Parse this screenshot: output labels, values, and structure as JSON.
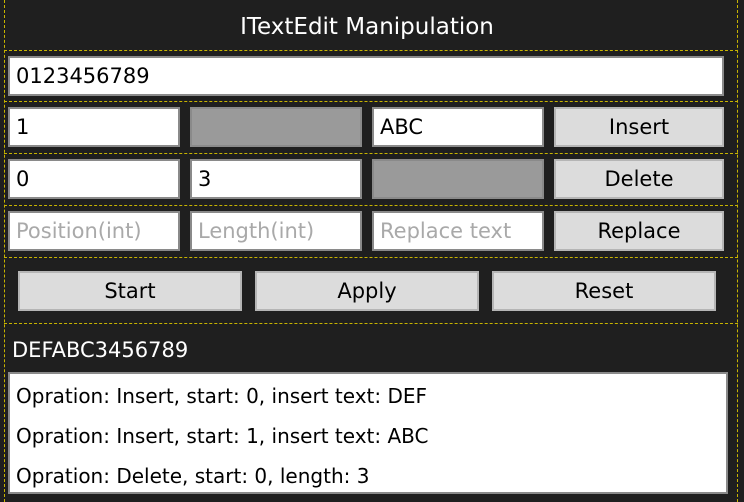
{
  "title": "ITextEdit Manipulation",
  "text_value": "0123456789",
  "insert_row": {
    "position": "1",
    "text": "ABC",
    "button": "Insert"
  },
  "delete_row": {
    "position": "0",
    "length": "3",
    "button": "Delete"
  },
  "replace_row": {
    "position_placeholder": "Position(int)",
    "length_placeholder": "Length(int)",
    "text_placeholder": "Replace text",
    "button": "Replace"
  },
  "actions": {
    "start": "Start",
    "apply": "Apply",
    "reset": "Reset"
  },
  "result_text": "DEFABC3456789",
  "log": [
    "Opration: Insert, start: 0, insert text: DEF",
    "Opration: Insert, start: 1, insert text: ABC",
    "Opration: Delete, start: 0, length: 3"
  ]
}
